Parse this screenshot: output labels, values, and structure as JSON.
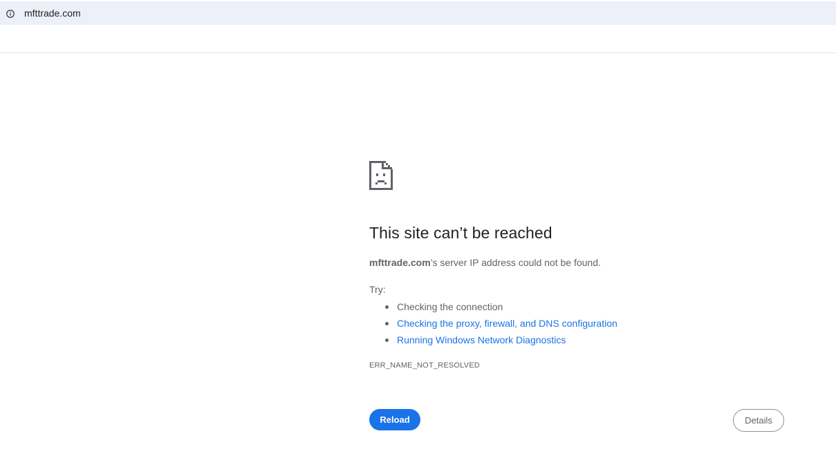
{
  "address_bar": {
    "url": "mfttrade.com",
    "icon": "info-icon"
  },
  "error_page": {
    "icon": "sad-document-icon",
    "title": "This site can’t be reached",
    "summary_host": "mfttrade.com",
    "summary_rest": "’s server IP address could not be found.",
    "try_label": "Try:",
    "suggestions": [
      {
        "label": "Checking the connection",
        "is_link": false
      },
      {
        "label": "Checking the proxy, firewall, and DNS configuration",
        "is_link": true
      },
      {
        "label": "Running Windows Network Diagnostics",
        "is_link": true
      }
    ],
    "error_code": "ERR_NAME_NOT_RESOLVED",
    "reload_label": "Reload",
    "details_label": "Details"
  },
  "colors": {
    "accent": "#1a73e8",
    "text_secondary": "#5f6368",
    "title": "#202124",
    "address_bar_bg": "#edf0f9"
  }
}
